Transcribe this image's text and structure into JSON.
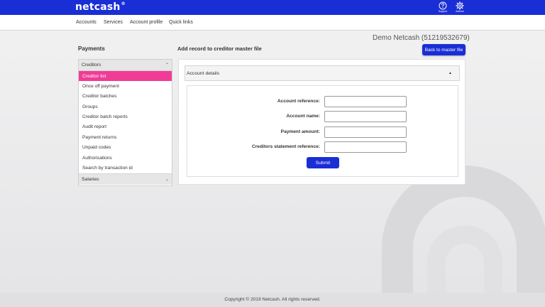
{
  "header": {
    "logo": "netcash",
    "logo_mark": "®",
    "support_label": "Support",
    "actions_label": "Actions",
    "support_icon": "question-circle-icon",
    "actions_icon": "gear-icon"
  },
  "nav": {
    "items": [
      "Accounts",
      "Services",
      "Account profile",
      "Quick links"
    ]
  },
  "account_title": "Demo Netcash (51219532679)",
  "sidebar": {
    "title": "Payments",
    "section": "Creditors",
    "items": [
      "Creditor list",
      "Once off payment",
      "Creditor batches",
      "Groups",
      "Creditor batch reports",
      "Audit report",
      "Payment returns",
      "Unpaid codes",
      "Authorisations",
      "Search by transaction id"
    ],
    "active_index": 0,
    "collapsed_section": "Salaries"
  },
  "main": {
    "title": "Add record to creditor master file",
    "back_button": "Back to master file",
    "section_title": "Account details",
    "form": {
      "fields": [
        {
          "label": "Account reference:",
          "value": ""
        },
        {
          "label": "Account name:",
          "value": ""
        },
        {
          "label": "Payment amount:",
          "value": ""
        },
        {
          "label": "Creditors statement reference:",
          "value": ""
        }
      ],
      "submit": "Submit"
    }
  },
  "footer": {
    "copyright": "Copyright © 2019 Netcash. All rights reserved."
  },
  "colors": {
    "brand_blue": "#1a2ed6",
    "active_pink": "#f03c96"
  }
}
